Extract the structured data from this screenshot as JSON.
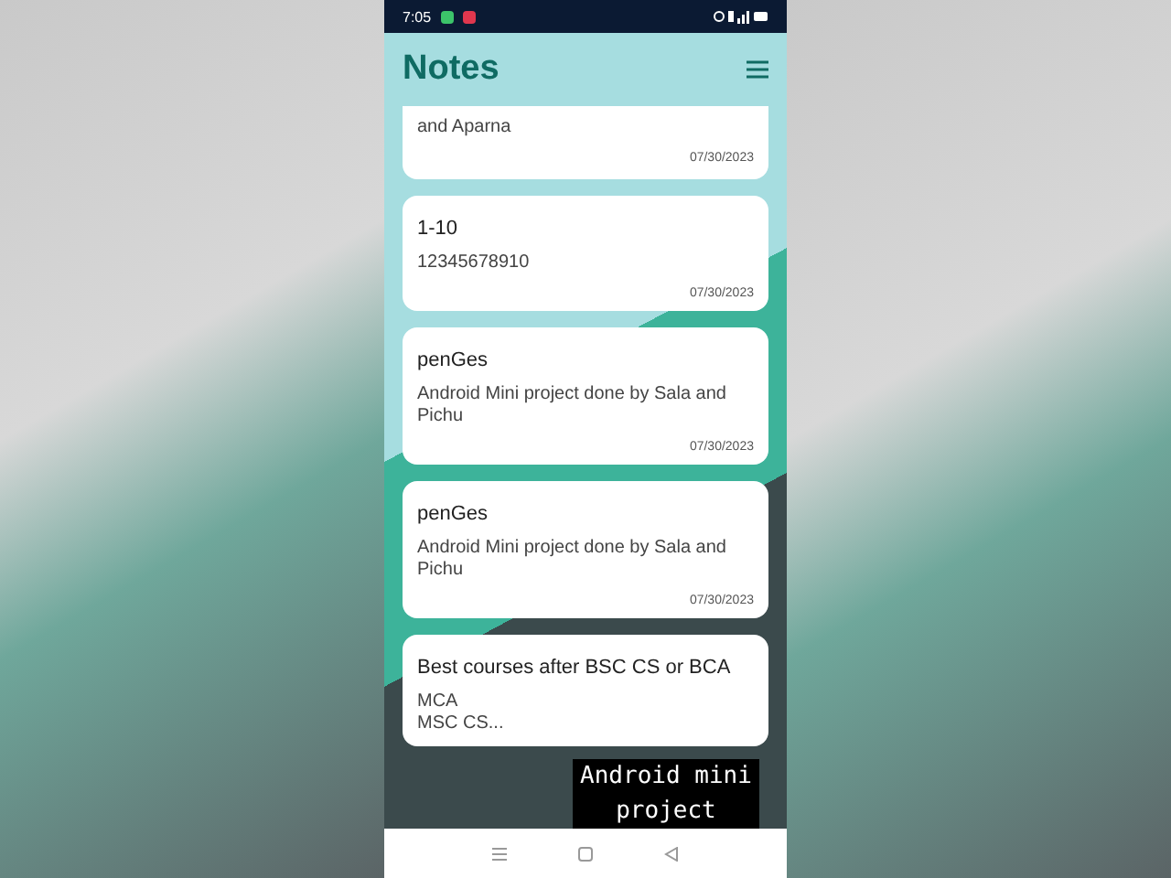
{
  "status_bar": {
    "time": "7:05"
  },
  "app_bar": {
    "title": "Notes"
  },
  "notes": [
    {
      "body": "and Aparna",
      "date": "07/30/2023"
    },
    {
      "title": "1-10",
      "body": "12345678910",
      "date": "07/30/2023"
    },
    {
      "title": "penGes",
      "body": "Android Mini project done by Sala and Pichu",
      "date": "07/30/2023"
    },
    {
      "title": "penGes",
      "body": "Android Mini project done by Sala and Pichu",
      "date": "07/30/2023"
    },
    {
      "title": "Best courses after BSC CS or BCA",
      "body": "MCA\nMSC CS..."
    }
  ],
  "caption": "Android mini project"
}
